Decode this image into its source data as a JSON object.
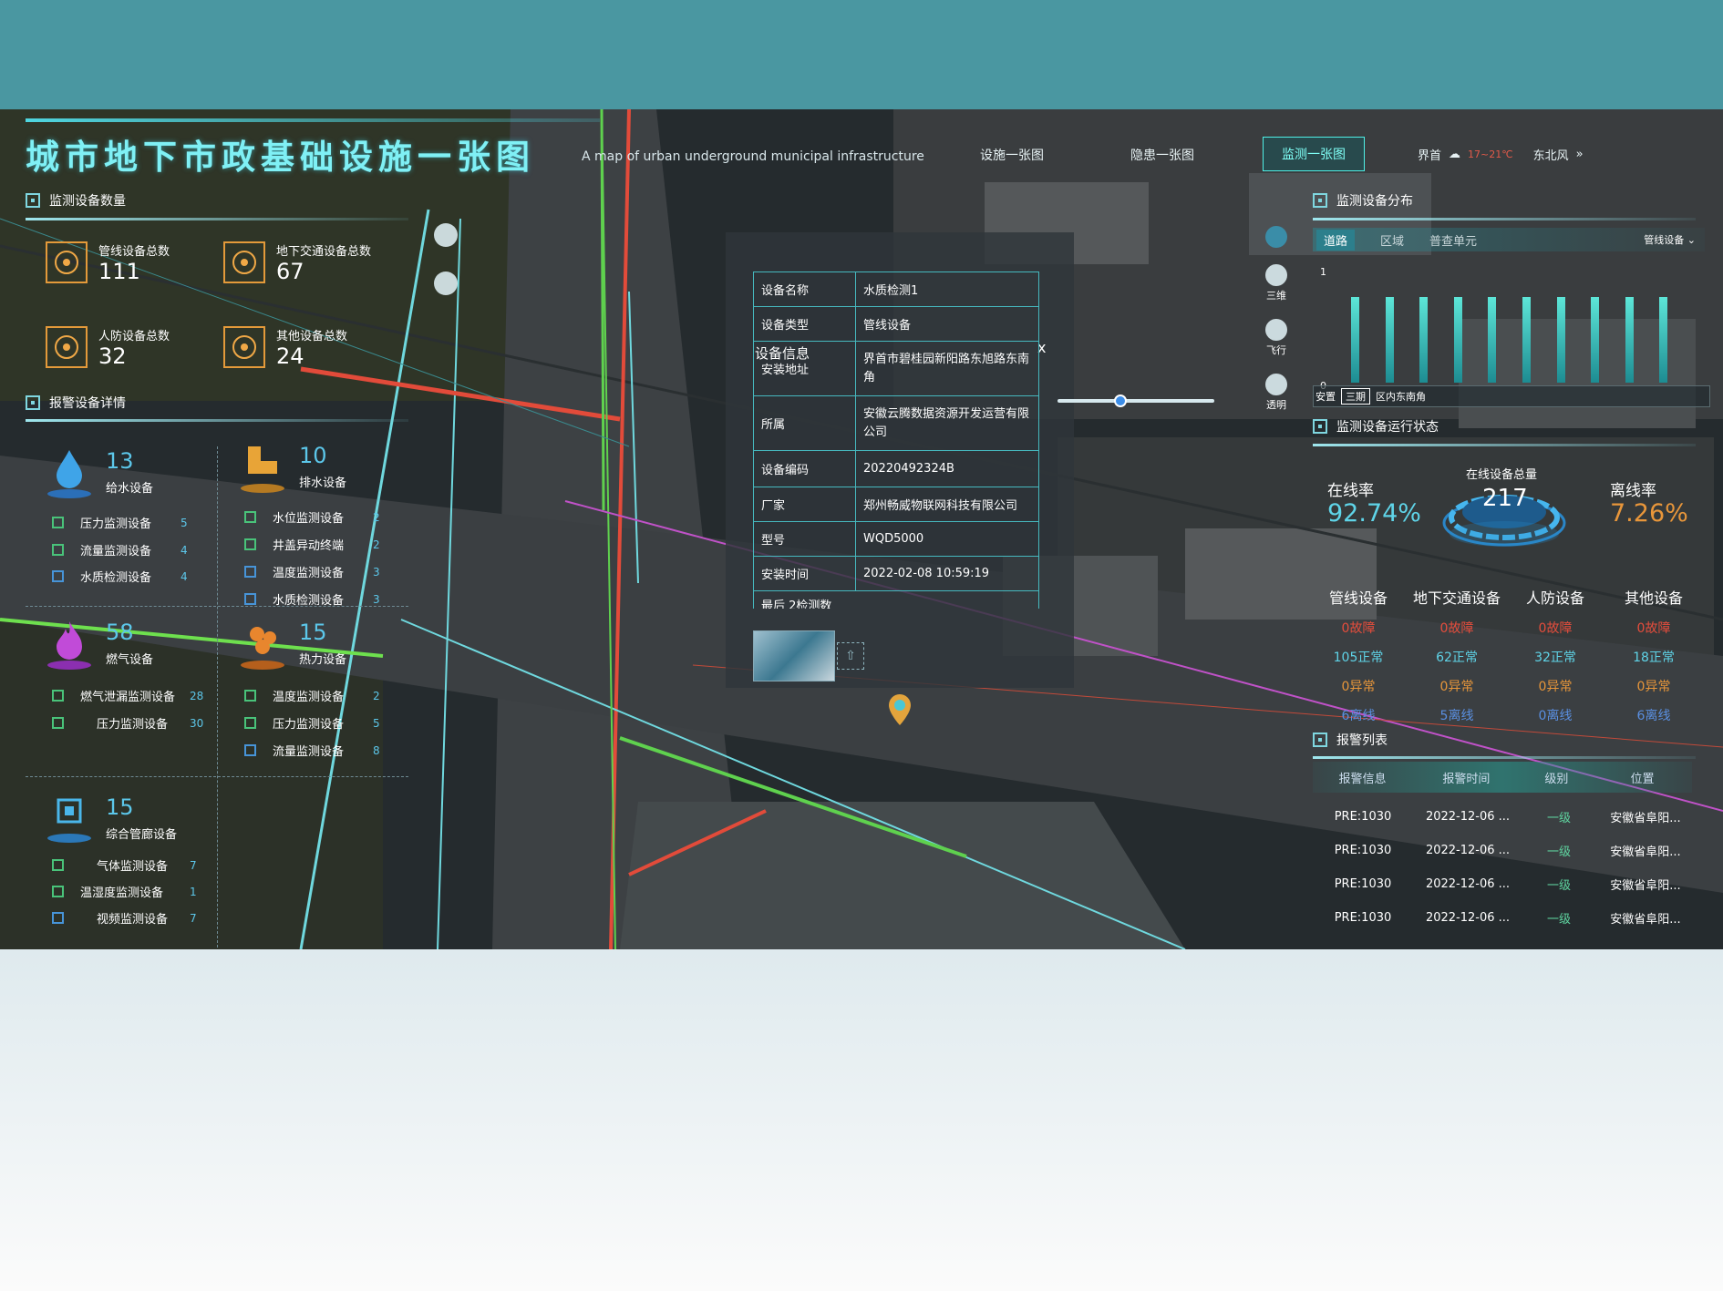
{
  "header": {
    "title": "城市地下市政基础设施一张图",
    "subtitle": "A map of urban underground municipal infrastructure",
    "tabs": [
      "设施一张图",
      "隐患一张图",
      "监测一张图"
    ],
    "weather": {
      "city": "界首",
      "temp": "17~21℃",
      "wind": "东北风"
    }
  },
  "left": {
    "sec1_title": "监测设备数量",
    "stats": [
      {
        "label": "管线设备总数",
        "value": "111"
      },
      {
        "label": "地下交通设备总数",
        "value": "67"
      },
      {
        "label": "人防设备总数",
        "value": "32"
      },
      {
        "label": "其他设备总数",
        "value": "24"
      }
    ],
    "sec2_title": "报警设备详情",
    "categories": [
      {
        "num": "13",
        "label": "给水设备",
        "icon": "water-drop-icon",
        "items": [
          {
            "name": "压力监测设备",
            "count": "5"
          },
          {
            "name": "流量监测设备",
            "count": "4"
          },
          {
            "name": "水质检测设备",
            "count": "4"
          }
        ]
      },
      {
        "num": "10",
        "label": "排水设备",
        "icon": "drain-pipe-icon",
        "items": [
          {
            "name": "水位监测设备",
            "count": "2"
          },
          {
            "name": "井盖异动终端",
            "count": "2"
          },
          {
            "name": "温度监测设备",
            "count": "3"
          },
          {
            "name": "水质检测设备",
            "count": "3"
          }
        ]
      },
      {
        "num": "58",
        "label": "燃气设备",
        "icon": "flame-icon",
        "items": [
          {
            "name": "燃气泄漏监测设备",
            "count": "28"
          },
          {
            "name": "压力监测设备",
            "count": "30"
          }
        ]
      },
      {
        "num": "15",
        "label": "热力设备",
        "icon": "heat-icon",
        "items": [
          {
            "name": "温度监测设备",
            "count": "2"
          },
          {
            "name": "压力监测设备",
            "count": "5"
          },
          {
            "name": "流量监测设备",
            "count": "8"
          }
        ]
      },
      {
        "num": "15",
        "label": "综合管廊设备",
        "icon": "chip-icon",
        "items": [
          {
            "name": "气体监测设备",
            "count": "7"
          },
          {
            "name": "温湿度监测设备",
            "count": "1"
          },
          {
            "name": "视频监测设备",
            "count": "7"
          }
        ]
      }
    ]
  },
  "popup": {
    "title": "设备信息",
    "close": "x",
    "rows": [
      {
        "k": "设备名称",
        "v": "水质检测1"
      },
      {
        "k": "设备类型",
        "v": "管线设备"
      },
      {
        "k": "安装地址",
        "v": "界首市碧桂园新阳路东旭路东南角"
      },
      {
        "k": "所属",
        "v": "安徽云腾数据资源开发运营有限公司"
      },
      {
        "k": "设备编码",
        "v": "20220492324B"
      },
      {
        "k": "厂家",
        "v": "郑州畅威物联网科技有限公司"
      },
      {
        "k": "型号",
        "v": "WQD5000"
      },
      {
        "k": "安装时间",
        "v": "2022-02-08 10:59:19"
      }
    ],
    "partial_row": "最后 2检测数"
  },
  "side_tools": [
    "三维",
    "飞行",
    "透明"
  ],
  "right": {
    "dist_title": "监测设备分布",
    "dist_tabs": [
      "道路",
      "区域",
      "普查单元"
    ],
    "dropdown": "管线设备",
    "bars_axis_top": "1",
    "bars_axis_bottom": "0",
    "bars": [
      0.78,
      0.78,
      0.78,
      0.78,
      0.78,
      0.78,
      0.78,
      0.78,
      0.78,
      0.78
    ],
    "scroll_labels": [
      "安置",
      "三期",
      "区内东南角"
    ],
    "status_title": "监测设备运行状态",
    "online_label": "在线率",
    "online_value": "92.74%",
    "total_label": "在线设备总量",
    "total_value": "217",
    "offline_label": "离线率",
    "offline_value": "7.26%",
    "status_cols": [
      {
        "name": "管线设备",
        "fault": "0故障",
        "normal": "105正常",
        "abnormal": "0异常",
        "offline": "6离线"
      },
      {
        "name": "地下交通设备",
        "fault": "0故障",
        "normal": "62正常",
        "abnormal": "0异常",
        "offline": "5离线"
      },
      {
        "name": "人防设备",
        "fault": "0故障",
        "normal": "32正常",
        "abnormal": "0异常",
        "offline": "0离线"
      },
      {
        "name": "其他设备",
        "fault": "0故障",
        "normal": "18正常",
        "abnormal": "0异常",
        "offline": "6离线"
      }
    ],
    "alarm_title": "报警列表",
    "alarm_headers": [
      "报警信息",
      "报警时间",
      "级别",
      "位置"
    ],
    "alarm_rows": [
      [
        "PRE:1030",
        "2022-12-06 ...",
        "一级",
        "安徽省阜阳..."
      ],
      [
        "PRE:1030",
        "2022-12-06 ...",
        "一级",
        "安徽省阜阳..."
      ],
      [
        "PRE:1030",
        "2022-12-06 ...",
        "一级",
        "安徽省阜阳..."
      ],
      [
        "PRE:1030",
        "2022-12-06 ...",
        "一级",
        "安徽省阜阳..."
      ]
    ]
  },
  "colors": {
    "accent": "#7ff0f5",
    "online": "#5fd4e8",
    "offline": "#e8963a",
    "fault": "#e64d3c"
  }
}
